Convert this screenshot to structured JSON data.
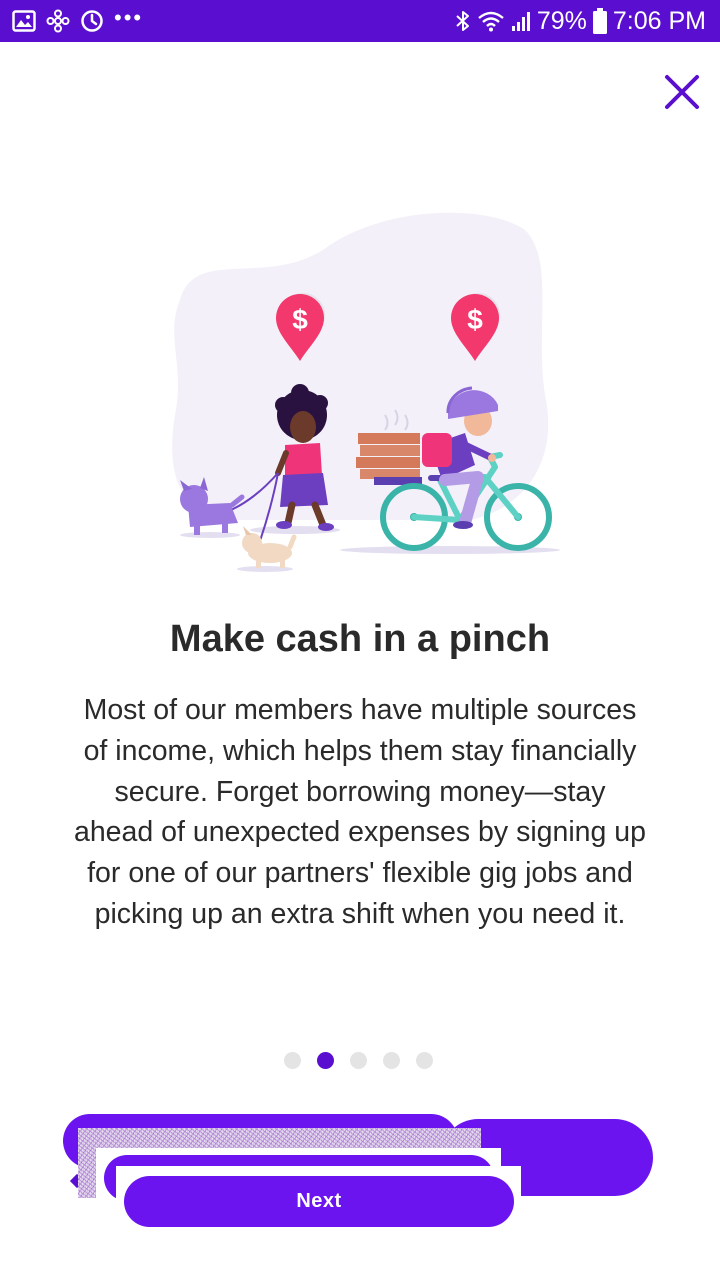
{
  "status_bar": {
    "battery_percent": "79%",
    "time": "7:06 PM",
    "overflow": "•••",
    "background_color": "#5a0fd0",
    "left_icons": [
      "gallery-icon",
      "settings-flower-icon",
      "sync-icon"
    ],
    "right_icons": [
      "bluetooth-icon",
      "wifi-icon",
      "signal-icon",
      "battery-icon"
    ]
  },
  "dialog": {
    "close_icon": "close-icon",
    "accent_color": "#5a0fd0"
  },
  "illustration": {
    "pins": [
      {
        "symbol": "$",
        "color": "#f2386c"
      },
      {
        "symbol": "$",
        "color": "#f2386c"
      }
    ]
  },
  "content": {
    "title": "Make cash in a pinch",
    "lines": [
      "Most of our members have multiple sources",
      "of income, which helps them stay financially",
      "secure. Forget borrowing money—stay",
      "ahead of unexpected expenses by signing up",
      "for one of our partners' flexible gig jobs and",
      "picking up an extra shift when you need it."
    ]
  },
  "pager": {
    "total": 5,
    "active_index": 1
  },
  "actions": {
    "next_label": "Next",
    "button_color": "#6b14f0"
  }
}
